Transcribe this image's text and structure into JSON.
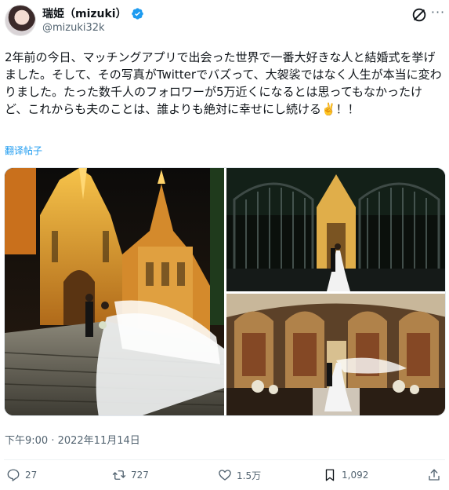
{
  "author": {
    "display_name": "瑞姫（mizuki）",
    "handle": "@mizuki32k",
    "verified_icon": "verified-badge-icon",
    "brand_color": "#1d9bf0"
  },
  "tweet": {
    "text": "2年前の今日、マッチングアプリで出会った世界で一番大好きな人と結婚式を挙げました。そして、その写真がTwitterでバズって、大袈裟ではなく人生が本当に変わりました。たった数千人のフォロワーが5万近くになるとは思ってもなかったけど、これからも夫のことは、誰よりも絶対に幸せにし続ける✌️！！",
    "translate_label": "翻译帖子",
    "timestamp": "下午9:00 · 2022年11月14日"
  },
  "media": {
    "photos": [
      {
        "name": "cathedral-steps-photo",
        "subject": "couple on illuminated cathedral steps"
      },
      {
        "name": "gate-photo",
        "subject": "couple at iron gate at night"
      },
      {
        "name": "chapel-interior-photo",
        "subject": "couple inside chapel"
      }
    ]
  },
  "actions": {
    "reply_count": "27",
    "retweet_count": "727",
    "like_count": "1.5万",
    "bookmark_count": "1,092"
  }
}
